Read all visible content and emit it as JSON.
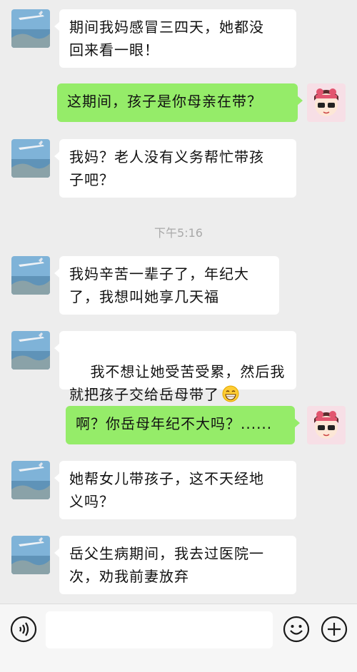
{
  "messages": [
    {
      "side": "left",
      "text": "期间我妈感冒三四天，她都没\n回来看一眼！"
    },
    {
      "side": "right",
      "text": "这期间，孩子是你母亲在带？"
    },
    {
      "side": "left",
      "text": "我妈？老人没有义务帮忙带孩\n子吧？"
    },
    {
      "side": "left",
      "text": "我妈辛苦一辈子了，年纪大\n了，我想叫她享几天福"
    },
    {
      "side": "left",
      "text": "我不想让她受苦受累，然后我\n就把孩子交给岳母带了"
    },
    {
      "side": "right",
      "text": "啊？你岳母年纪不大吗？......"
    },
    {
      "side": "left",
      "text": "她帮女儿带孩子，这不天经地\n义吗？"
    },
    {
      "side": "left",
      "text": "岳父生病期间，我去过医院一\n次，劝我前妻放弃"
    }
  ],
  "timestamp": "下午5:16",
  "input": {
    "value": "",
    "placeholder": ""
  },
  "icons": {
    "voice": "voice-icon",
    "emoji": "emoji-icon",
    "plus": "plus-icon",
    "grin": "grin-emoji-icon"
  },
  "colors": {
    "background": "#ededed",
    "outgoing_bubble": "#95ec69",
    "incoming_bubble": "#ffffff"
  }
}
